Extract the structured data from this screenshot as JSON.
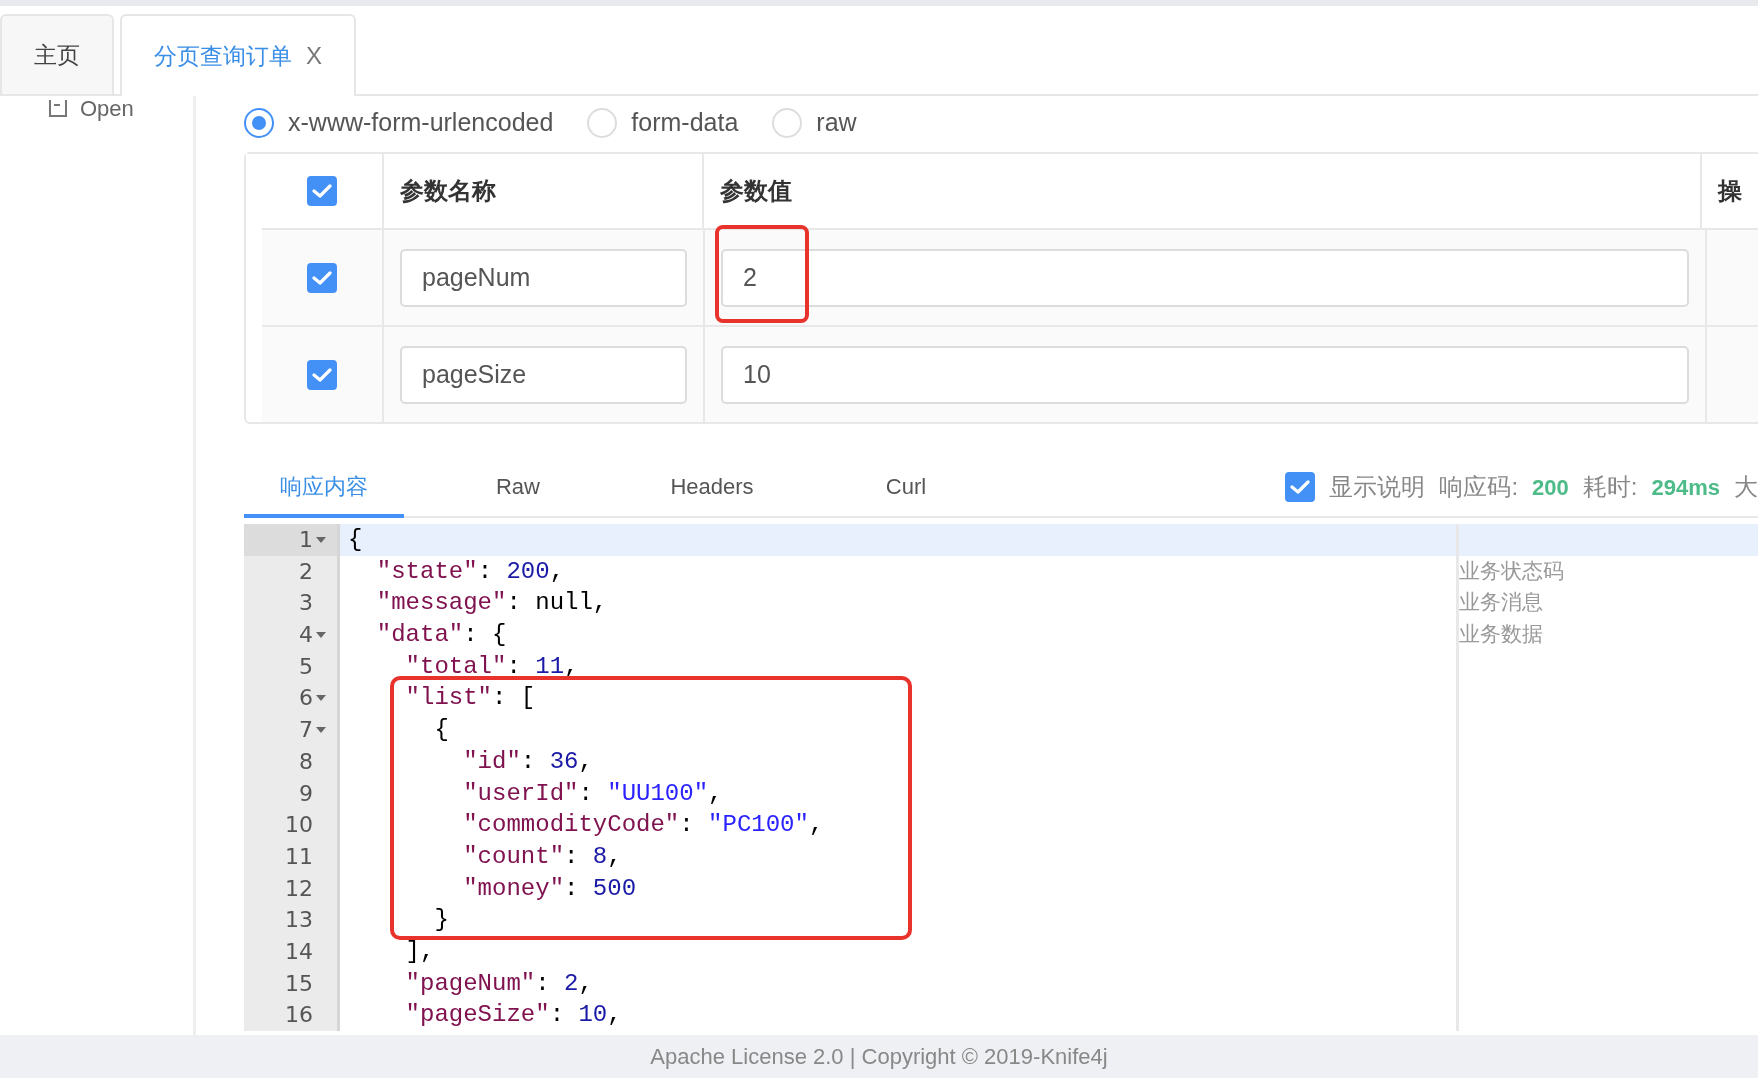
{
  "tabs": [
    {
      "label": "主页",
      "selected": false,
      "closable": false
    },
    {
      "label": "分页查询订单",
      "selected": true,
      "closable": true,
      "close_label": "X"
    }
  ],
  "sidebar": {
    "items": [
      {
        "label": "Open"
      }
    ]
  },
  "body_types": [
    {
      "label": "x-www-form-urlencoded",
      "selected": true
    },
    {
      "label": "form-data",
      "selected": false
    },
    {
      "label": "raw",
      "selected": false
    }
  ],
  "params_table": {
    "all_checked": true,
    "columns": [
      "参数名称",
      "参数值",
      "操"
    ],
    "rows": [
      {
        "checked": true,
        "name": "pageNum",
        "value": "2",
        "highlighted": true
      },
      {
        "checked": true,
        "name": "pageSize",
        "value": "10",
        "highlighted": false
      }
    ]
  },
  "response_tabs": [
    {
      "label": "响应内容",
      "selected": true
    },
    {
      "label": "Raw",
      "selected": false
    },
    {
      "label": "Headers",
      "selected": false
    },
    {
      "label": "Curl",
      "selected": false
    }
  ],
  "show_description": {
    "label": "显示说明",
    "checked": true
  },
  "status": [
    {
      "label": "响应码:",
      "value": "200"
    },
    {
      "label": "耗时:",
      "value": "294ms"
    },
    {
      "label": "大"
    }
  ],
  "code_lines": [
    {
      "number": "1",
      "foldable": true,
      "active": true,
      "highlighted": false,
      "tokens": [
        {
          "kind": "punct",
          "text": "{"
        }
      ]
    },
    {
      "number": "2",
      "foldable": false,
      "active": false,
      "highlighted": false,
      "note": "业务状态码",
      "tokens": [
        {
          "kind": "key",
          "text": "  \"state\""
        },
        {
          "kind": "punct",
          "text": ": "
        },
        {
          "kind": "number",
          "text": "200"
        },
        {
          "kind": "punct",
          "text": ","
        }
      ]
    },
    {
      "number": "3",
      "foldable": false,
      "active": false,
      "highlighted": false,
      "note": "业务消息",
      "tokens": [
        {
          "kind": "key",
          "text": "  \"message\""
        },
        {
          "kind": "punct",
          "text": ": null,"
        }
      ]
    },
    {
      "number": "4",
      "foldable": true,
      "active": false,
      "highlighted": false,
      "note": "业务数据",
      "tokens": [
        {
          "kind": "key",
          "text": "  \"data\""
        },
        {
          "kind": "punct",
          "text": ": {"
        }
      ]
    },
    {
      "number": "5",
      "foldable": false,
      "active": false,
      "highlighted": false,
      "tokens": [
        {
          "kind": "key",
          "text": "    \"total\""
        },
        {
          "kind": "punct",
          "text": ": "
        },
        {
          "kind": "number",
          "text": "11"
        },
        {
          "kind": "punct",
          "text": ","
        }
      ]
    },
    {
      "number": "6",
      "foldable": true,
      "active": false,
      "highlighted": true,
      "tokens": [
        {
          "kind": "key",
          "text": "    \"list\""
        },
        {
          "kind": "punct",
          "text": ": ["
        }
      ]
    },
    {
      "number": "7",
      "foldable": true,
      "active": false,
      "highlighted": true,
      "tokens": [
        {
          "kind": "punct",
          "text": "      {"
        }
      ]
    },
    {
      "number": "8",
      "foldable": false,
      "active": false,
      "highlighted": true,
      "tokens": [
        {
          "kind": "key",
          "text": "        \"id\""
        },
        {
          "kind": "punct",
          "text": ": "
        },
        {
          "kind": "number",
          "text": "36"
        },
        {
          "kind": "punct",
          "text": ","
        }
      ]
    },
    {
      "number": "9",
      "foldable": false,
      "active": false,
      "highlighted": true,
      "tokens": [
        {
          "kind": "key",
          "text": "        \"userId\""
        },
        {
          "kind": "punct",
          "text": ": "
        },
        {
          "kind": "string",
          "text": "\"UU100\""
        },
        {
          "kind": "punct",
          "text": ","
        }
      ]
    },
    {
      "number": "10",
      "foldable": false,
      "active": false,
      "highlighted": true,
      "tokens": [
        {
          "kind": "key",
          "text": "        \"commodityCode\""
        },
        {
          "kind": "punct",
          "text": ": "
        },
        {
          "kind": "string",
          "text": "\"PC100\""
        },
        {
          "kind": "punct",
          "text": ","
        }
      ]
    },
    {
      "number": "11",
      "foldable": false,
      "active": false,
      "highlighted": true,
      "tokens": [
        {
          "kind": "key",
          "text": "        \"count\""
        },
        {
          "kind": "punct",
          "text": ": "
        },
        {
          "kind": "number",
          "text": "8"
        },
        {
          "kind": "punct",
          "text": ","
        }
      ]
    },
    {
      "number": "12",
      "foldable": false,
      "active": false,
      "highlighted": true,
      "tokens": [
        {
          "kind": "key",
          "text": "        \"money\""
        },
        {
          "kind": "punct",
          "text": ": "
        },
        {
          "kind": "number",
          "text": "500"
        }
      ]
    },
    {
      "number": "13",
      "foldable": false,
      "active": false,
      "highlighted": true,
      "tokens": [
        {
          "kind": "punct",
          "text": "      }"
        }
      ]
    },
    {
      "number": "14",
      "foldable": false,
      "active": false,
      "highlighted": false,
      "tokens": [
        {
          "kind": "punct",
          "text": "    ],"
        }
      ]
    },
    {
      "number": "15",
      "foldable": false,
      "active": false,
      "highlighted": false,
      "tokens": [
        {
          "kind": "key",
          "text": "    \"pageNum\""
        },
        {
          "kind": "punct",
          "text": ": "
        },
        {
          "kind": "number",
          "text": "2"
        },
        {
          "kind": "punct",
          "text": ","
        }
      ]
    },
    {
      "number": "16",
      "foldable": false,
      "active": false,
      "highlighted": false,
      "tokens": [
        {
          "kind": "key",
          "text": "    \"pageSize\""
        },
        {
          "kind": "punct",
          "text": ": "
        },
        {
          "kind": "number",
          "text": "10"
        },
        {
          "kind": "punct",
          "text": ","
        }
      ]
    }
  ],
  "footer": {
    "text": "Apache License 2.0 | Copyright © 2019-Knife4j"
  }
}
